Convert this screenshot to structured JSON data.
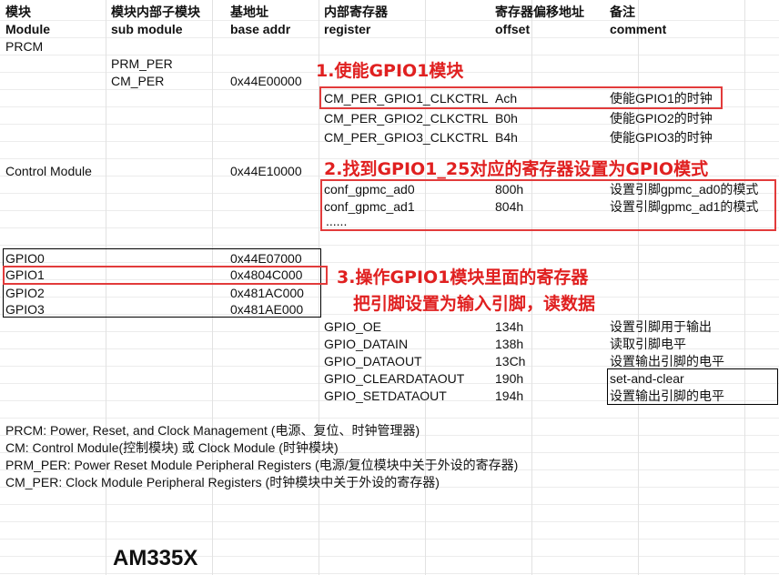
{
  "header": {
    "c1": "模块",
    "c2": "模块内部子模块",
    "c3": "基地址",
    "c4": "内部寄存器",
    "c5": "寄存器偏移地址",
    "c6": "备注",
    "e1": "Module",
    "e2": "sub module",
    "e3": "base addr",
    "e4": "register",
    "e5": "offset",
    "e6": "comment"
  },
  "prcm": {
    "module": "PRCM",
    "sub1": "PRM_PER",
    "sub2": "CM_PER",
    "base": "0x44E00000",
    "regs": [
      {
        "name": "CM_PER_GPIO1_CLKCTRL",
        "offset": "Ach",
        "comment": "使能GPIO1的时钟"
      },
      {
        "name": "CM_PER_GPIO2_CLKCTRL",
        "offset": "B0h",
        "comment": "使能GPIO2的时钟"
      },
      {
        "name": "CM_PER_GPIO3_CLKCTRL",
        "offset": "B4h",
        "comment": "使能GPIO3的时钟"
      }
    ]
  },
  "control": {
    "module": "Control Module",
    "base": "0x44E10000",
    "regs": [
      {
        "name": "conf_gpmc_ad0",
        "offset": "800h",
        "comment": "设置引脚gpmc_ad0的模式"
      },
      {
        "name": "conf_gpmc_ad1",
        "offset": "804h",
        "comment": "设置引脚gpmc_ad1的模式"
      }
    ],
    "ellipsis": "......"
  },
  "gpio": {
    "modules": [
      {
        "name": "GPIO0",
        "base": "0x44E07000"
      },
      {
        "name": "GPIO1",
        "base": "0x4804C000"
      },
      {
        "name": "GPIO2",
        "base": "0x481AC000"
      },
      {
        "name": "GPIO3",
        "base": "0x481AE000"
      }
    ],
    "regs": [
      {
        "name": "GPIO_OE",
        "offset": "134h",
        "comment": "设置引脚用于输出"
      },
      {
        "name": "GPIO_DATAIN",
        "offset": "138h",
        "comment": "读取引脚电平"
      },
      {
        "name": "GPIO_DATAOUT",
        "offset": "13Ch",
        "comment": "设置输出引脚的电平"
      },
      {
        "name": "GPIO_CLEARDATAOUT",
        "offset": "190h",
        "comment": "set-and-clear"
      },
      {
        "name": "GPIO_SETDATAOUT",
        "offset": "194h",
        "comment": "设置输出引脚的电平"
      }
    ]
  },
  "annotations": {
    "a1": "1.使能GPIO1模块",
    "a2": "2.找到GPIO1_25对应的寄存器设置为GPIO模式",
    "a3": "3.操作GPIO1模块里面的寄存器",
    "a3b": "把引脚设置为输入引脚，读数据"
  },
  "notes": [
    "PRCM: Power, Reset, and Clock Management (电源、复位、时钟管理器)",
    "CM: Control Module(控制模块) 或 Clock Module (时钟模块)",
    "PRM_PER: Power Reset Module Peripheral Registers (电源/复位模块中关于外设的寄存器)",
    "CM_PER: Clock Module Peripheral Registers (时钟模块中关于外设的寄存器)"
  ],
  "chip": "AM335X",
  "colors": {
    "annotation": "#e02020",
    "box_red": "#e23b3b",
    "grid": "#e2e2e2"
  }
}
